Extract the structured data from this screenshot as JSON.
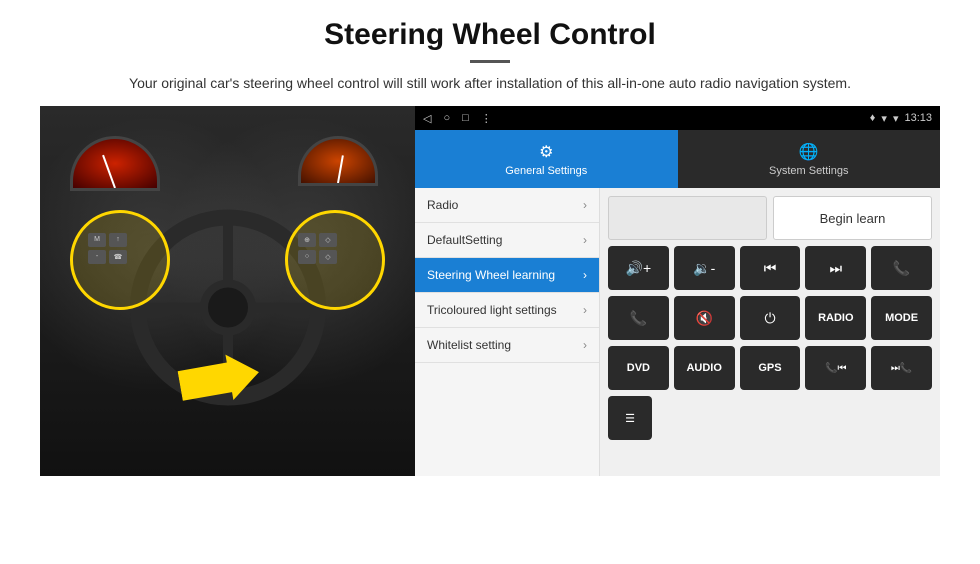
{
  "page": {
    "title": "Steering Wheel Control",
    "divider": "",
    "subtitle": "Your original car's steering wheel control will still work after installation of this all-in-one auto radio navigation system."
  },
  "status_bar": {
    "nav_back": "◁",
    "nav_home": "○",
    "nav_square": "□",
    "nav_menu": "⋮",
    "signal": "▼",
    "wifi": "▾",
    "time": "13:13",
    "location": "♦"
  },
  "tabs": {
    "active_label": "General Settings",
    "inactive_label": "System Settings"
  },
  "menu": {
    "items": [
      {
        "label": "Radio",
        "active": false
      },
      {
        "label": "DefaultSetting",
        "active": false
      },
      {
        "label": "Steering Wheel learning",
        "active": true
      },
      {
        "label": "Tricoloured light settings",
        "active": false
      },
      {
        "label": "Whitelist setting",
        "active": false
      }
    ]
  },
  "controls": {
    "begin_learn_label": "Begin learn",
    "row1": [
      {
        "icon": "🔊+",
        "label": "vol_up"
      },
      {
        "icon": "🔊-",
        "label": "vol_down"
      },
      {
        "icon": "⏮",
        "label": "prev_track"
      },
      {
        "icon": "⏭",
        "label": "next_track"
      },
      {
        "icon": "📞",
        "label": "phone"
      }
    ],
    "row2": [
      {
        "icon": "📞",
        "label": "answer"
      },
      {
        "icon": "🔇",
        "label": "mute"
      },
      {
        "icon": "⏻",
        "label": "power"
      },
      {
        "text": "RADIO",
        "label": "radio_btn"
      },
      {
        "text": "MODE",
        "label": "mode_btn"
      }
    ],
    "row3": [
      {
        "text": "DVD",
        "label": "dvd_btn"
      },
      {
        "text": "AUDIO",
        "label": "audio_btn"
      },
      {
        "text": "GPS",
        "label": "gps_btn"
      },
      {
        "icon": "📞⏮",
        "label": "phone_prev"
      },
      {
        "icon": "⏭📞",
        "label": "phone_next"
      }
    ],
    "row4": [
      {
        "icon": "☰",
        "label": "menu_icon"
      }
    ]
  }
}
